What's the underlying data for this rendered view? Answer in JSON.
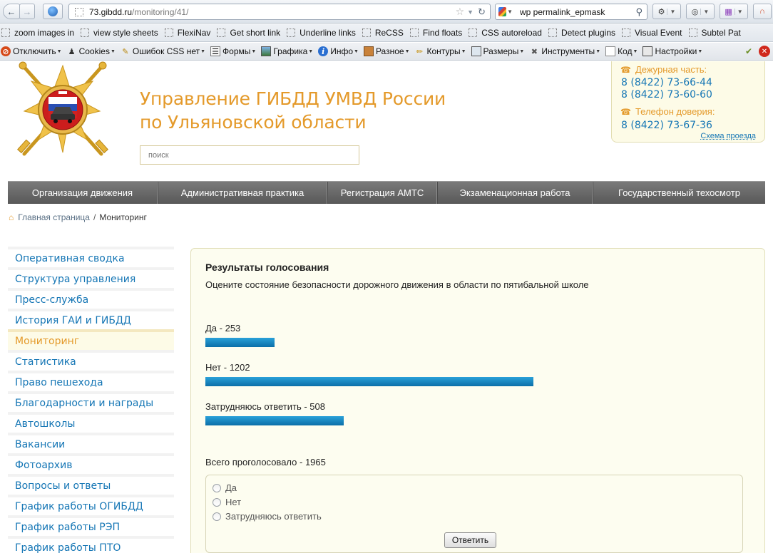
{
  "browser": {
    "url_host": "73.gibdd.ru",
    "url_path": "/monitoring/41/",
    "search_query": "wp permalink_epmask",
    "bookmarks": [
      "zoom images in",
      "view style sheets",
      "FlexiNav",
      "Get short link",
      "Underline links",
      "ReCSS",
      "Find floats",
      "CSS autoreload",
      "Detect plugins",
      "Visual Event",
      "Subtel Pat"
    ],
    "devbar": {
      "disable": "Отключить",
      "cookies": "Cookies",
      "css_errors": "Ошибок CSS нет",
      "forms": "Формы",
      "images": "Графика",
      "info": "Инфо",
      "misc": "Разное",
      "outline": "Контуры",
      "resize": "Размеры",
      "tools": "Инструменты",
      "source": "Код",
      "options": "Настройки"
    }
  },
  "site": {
    "title_line1": "Управление ГИБДД УМВД России",
    "title_line2": "по Ульяновской области",
    "search_placeholder": "поиск",
    "contacts": {
      "duty_label": "Дежурная часть:",
      "duty_phone1": "8 (8422) 73-66-44",
      "duty_phone2": "8 (8422) 73-60-60",
      "trust_label": "Телефон доверия:",
      "trust_phone": "8 (8422) 73-67-36",
      "route_link": "Схема проезда"
    },
    "menu": [
      "Организация движения",
      "Административная практика",
      "Регистрация АМТС",
      "Экзаменационная работа",
      "Государственный техосмотр"
    ],
    "breadcrumb": {
      "home": "Главная страница",
      "separator": "/",
      "current": "Мониторинг"
    },
    "sidebar": [
      "Оперативная сводка",
      "Структура управления",
      "Пресс-служба",
      "История ГАИ и ГИБДД",
      "Мониторинг",
      "Статистика",
      "Право пешехода",
      "Благодарности и награды",
      "Автошколы",
      "Вакансии",
      "Фотоархив",
      "Вопросы и ответы",
      "График работы ОГИБДД",
      "График работы РЭП",
      "График работы ПТО"
    ],
    "sidebar_active_index": 4
  },
  "poll": {
    "title": "Результаты голосования",
    "question": "Оцените состояние безопасности дорожного движения в области по пятибальной школе",
    "results": [
      {
        "label": "Да - 253",
        "votes": 253
      },
      {
        "label": "Нет - 1202",
        "votes": 1202
      },
      {
        "label": "Затрудняюсь ответить - 508",
        "votes": 508
      }
    ],
    "total_label": "Всего проголосовало - 1965",
    "options": [
      "Да",
      "Нет",
      "Затрудняюсь ответить"
    ],
    "submit_label": "Ответить"
  },
  "colors": {
    "accent_orange": "#e49a2b",
    "link_blue": "#1576b5",
    "bar_blue": "#0b84c4",
    "menu_gray": "#686868",
    "panel_bg": "#fdfdf0"
  }
}
